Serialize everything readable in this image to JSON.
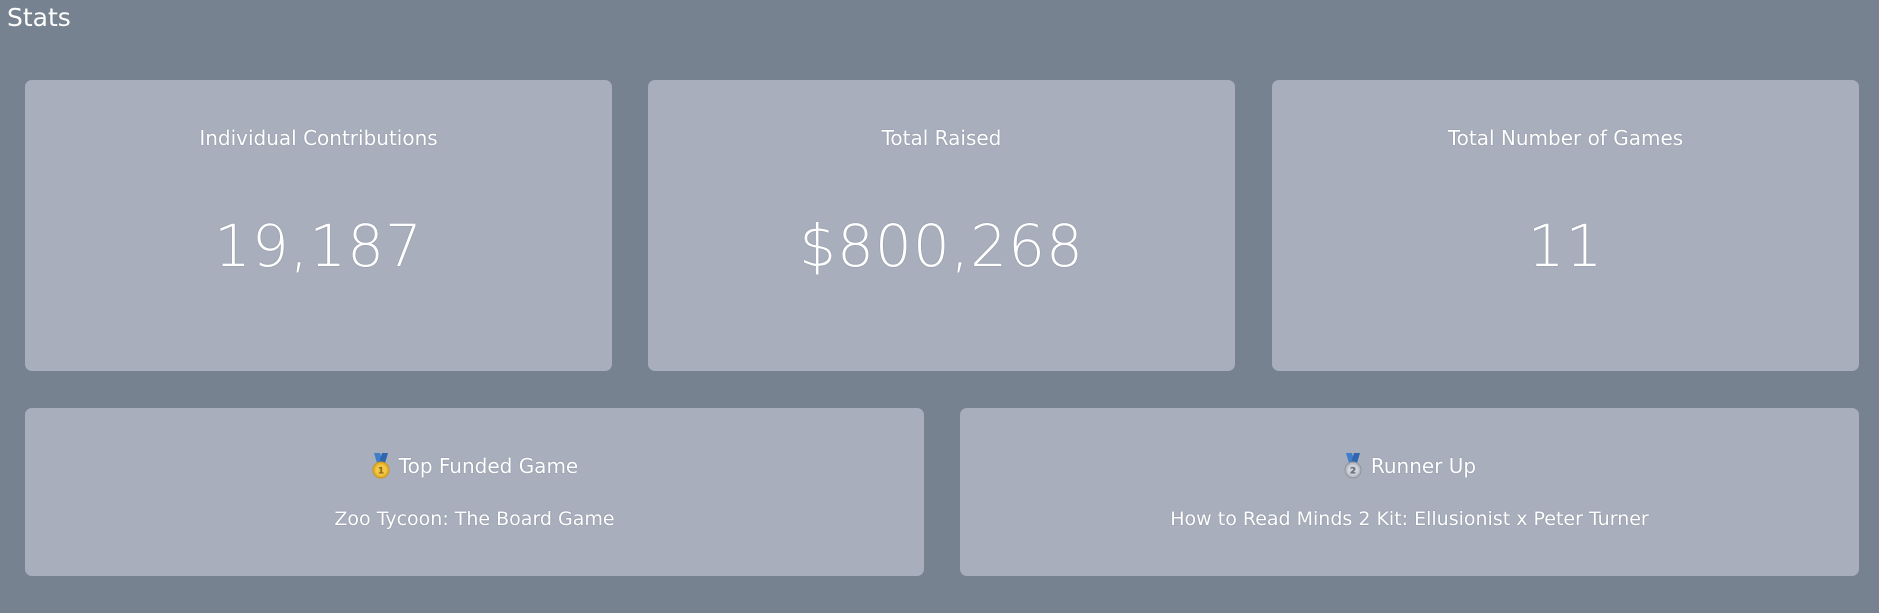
{
  "page": {
    "title": "Stats"
  },
  "stats": [
    {
      "label": "Individual Contributions",
      "value": "19,187"
    },
    {
      "label": "Total Raised",
      "value": "$800,268"
    },
    {
      "label": "Total Number of Games",
      "value": "11"
    }
  ],
  "top_funded": {
    "heading": "Top Funded Game",
    "icon": "first-place-medal-icon",
    "game": "Zoo Tycoon: The Board Game"
  },
  "runner_up": {
    "heading": "Runner Up",
    "icon": "second-place-medal-icon",
    "game": "How to Read Minds 2 Kit: Ellusionist x Peter Turner"
  },
  "colors": {
    "background": "#76828f",
    "card": "#a8aebc",
    "text": "#ffffff",
    "gold": "#e8b52a",
    "silver": "#b8bcc4",
    "ribbon": "#3f7fc9"
  }
}
